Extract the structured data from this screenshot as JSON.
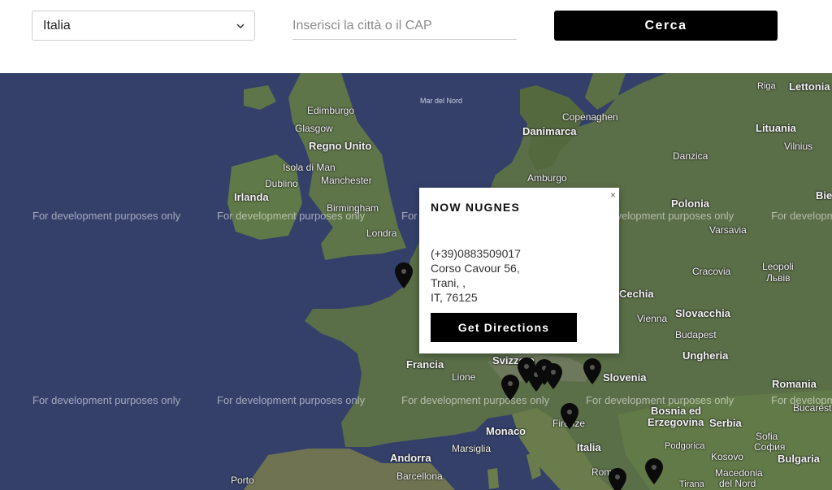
{
  "search": {
    "country_value": "Italia",
    "city_placeholder": "Inserisci la città o il CAP",
    "search_label": "Cerca"
  },
  "map": {
    "watermark": "For development purposes only",
    "sea_label": "Mar del Nord",
    "labels": {
      "riga": "Riga",
      "lettonia": "Lettonia",
      "edimburgo": "Edimburgo",
      "glasgow": "Glasgow",
      "copenaghen": "Copenaghen",
      "danimarca": "Danimarca",
      "lituania": "Lituania",
      "regno_unito": "Regno Unito",
      "vilnius": "Vilnius",
      "isola_di_man": "Isola di Man",
      "danzica": "Danzica",
      "manchester": "Manchester",
      "dublino": "Dublino",
      "amburgo": "Amburgo",
      "irlanda": "Irlanda",
      "polonia": "Polonia",
      "bie": "Bie",
      "birmingham": "Birmingham",
      "varsavia": "Varsavia",
      "londra": "Londra",
      "cracovia": "Cracovia",
      "leopoli": "Leopoli",
      "lvb": "Львів",
      "cechia": "Cechia",
      "slovacchia": "Slovacchia",
      "vienna": "Vienna",
      "budapest": "Budapest",
      "ungheria": "Ungheria",
      "francia": "Francia",
      "svizzera": "Svizzera",
      "lione": "Lione",
      "slovenia": "Slovenia",
      "romania": "Romania",
      "bucarest": "Bucarest",
      "bosnia": "Bosnia ed",
      "erzegovina": "Erzegovina",
      "serbia": "Serbia",
      "monaco": "Monaco",
      "firenze": "Firenze",
      "sofia": "Sofia",
      "cofna": "София",
      "italia": "Italia",
      "marsiglia": "Marsiglia",
      "podgorica": "Podgorica",
      "kosovo": "Kosovo",
      "bulgaria": "Bulgaria",
      "andorra": "Andorra",
      "macedonia": "Macedonia",
      "del_nord": "del Nord",
      "barcellona": "Barcellona",
      "roma": "Roma",
      "tirana": "Tirana",
      "porto": "Porto"
    }
  },
  "popup": {
    "close_symbol": "×",
    "store_name": "NOW NUGNES",
    "phone": "(+39)0883509017",
    "address": "Corso Cavour 56,",
    "city": "Trani, ,",
    "country_zip": "IT, 76125",
    "directions_label": "Get Directions"
  },
  "colors": {
    "sea": "#34406a",
    "land": "#5a6e48",
    "button": "#000000"
  }
}
